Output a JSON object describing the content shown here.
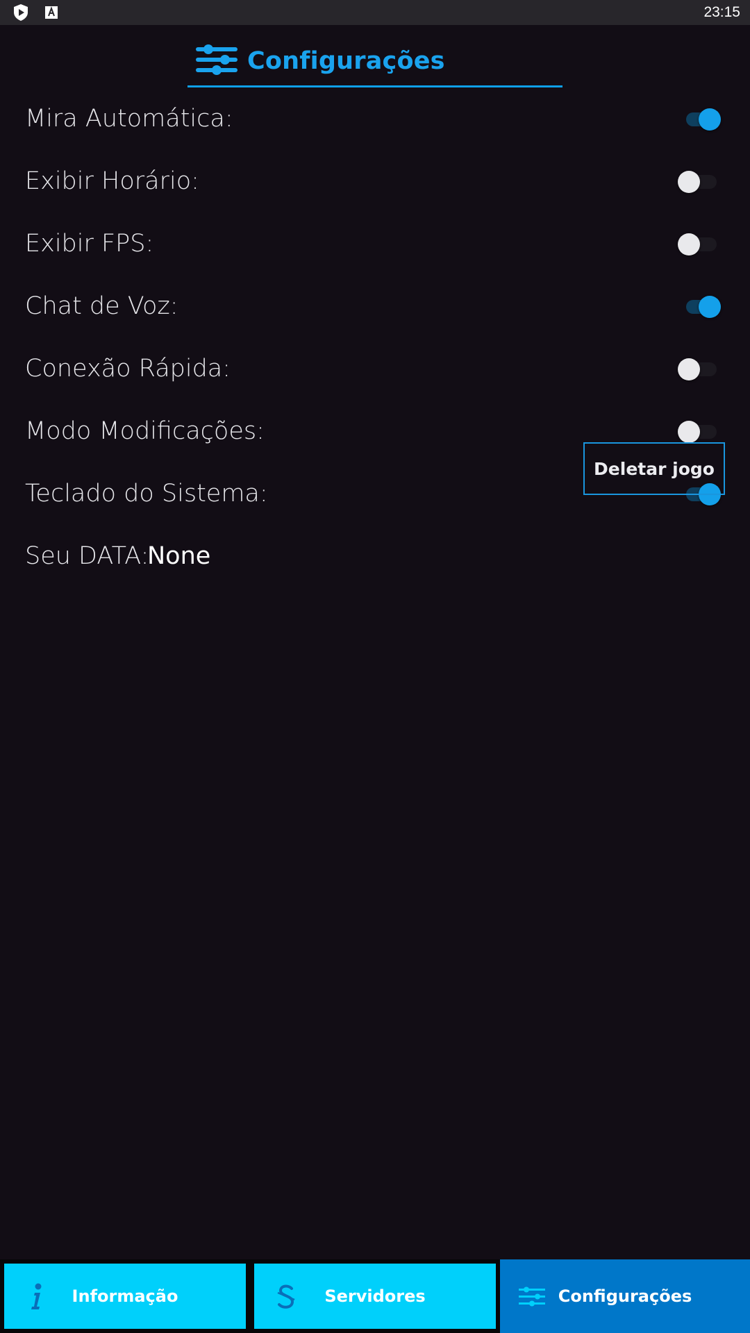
{
  "status_bar": {
    "time": "23:15",
    "icons": [
      "shield-play-icon",
      "a-box-icon"
    ]
  },
  "header": {
    "title": "Configurações",
    "icon": "sliders-icon"
  },
  "settings": [
    {
      "label": "Mira Automática:",
      "on": true
    },
    {
      "label": "Exibir Horário:",
      "on": false
    },
    {
      "label": "Exibir FPS:",
      "on": false
    },
    {
      "label": "Chat de Voz:",
      "on": true
    },
    {
      "label": "Conexão Rápida:",
      "on": false
    },
    {
      "label": "Modo Modificações:",
      "on": false
    },
    {
      "label": "Teclado do Sistema:",
      "on": true
    }
  ],
  "data_row": {
    "label": "Seu DATA:",
    "value": "None",
    "delete_label": "Deletar jogo"
  },
  "bottom_nav": {
    "info_label": "Informação",
    "servers_label": "Servidores",
    "config_label": "Configurações"
  },
  "colors": {
    "accent": "#1aa3ee",
    "nav_cyan": "#00d0fb",
    "nav_active": "#0077c9",
    "background": "#120d15"
  }
}
